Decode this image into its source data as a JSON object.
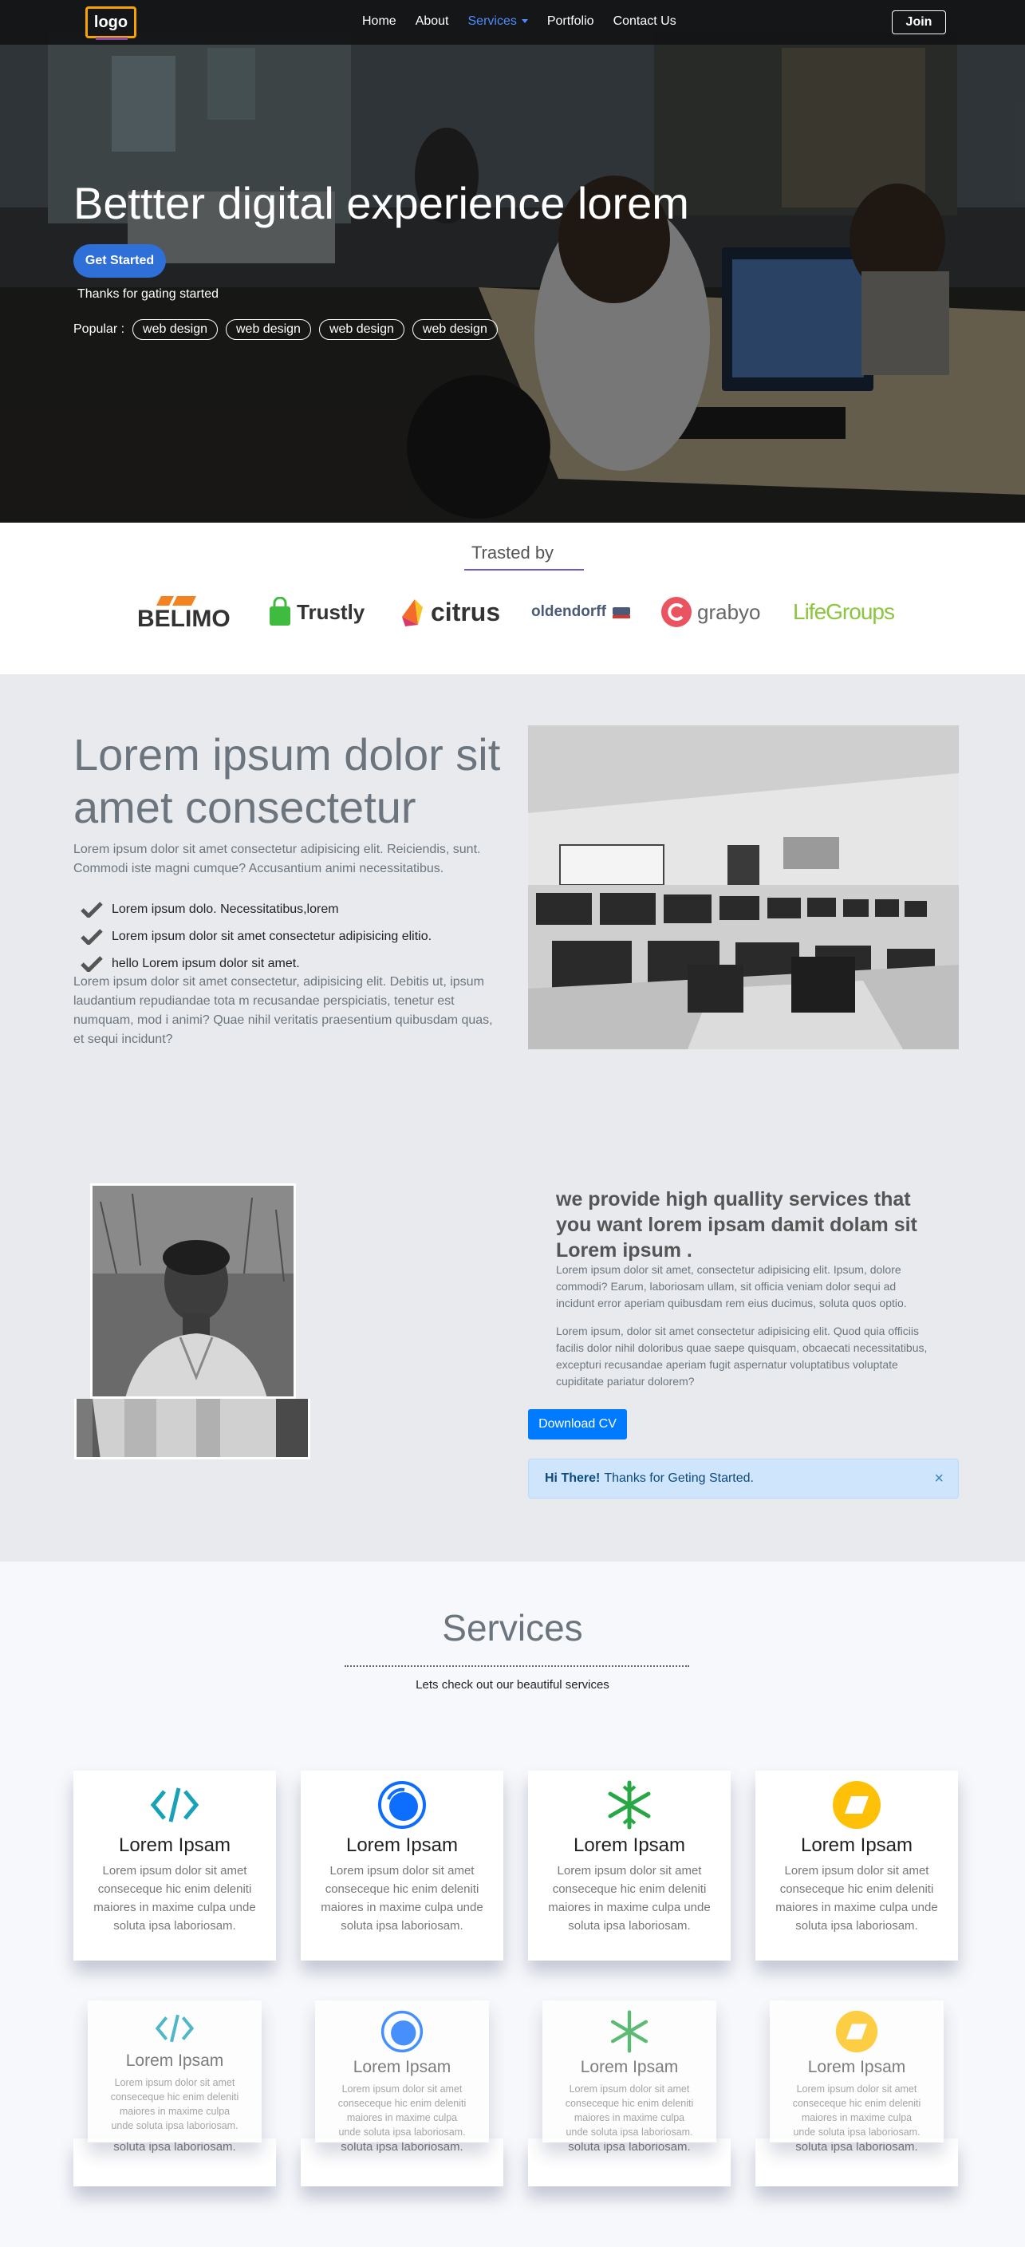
{
  "nav": {
    "logo": "logo",
    "links": [
      "Home",
      "About",
      "Services",
      "Portfolio",
      "Contact Us"
    ],
    "join": "Join"
  },
  "hero": {
    "title": "Bettter digital experience lorem",
    "cta": "Get Started",
    "thanks": "Thanks for gating started",
    "popular_label": "Popular :",
    "tags": [
      "web design",
      "web design",
      "web design",
      "web design"
    ]
  },
  "trusted": {
    "title": "Trasted by",
    "brands": [
      "BELIMO",
      "Trustly",
      "citrus",
      "oldendorff",
      "grabyo",
      "LifeGroups"
    ]
  },
  "about": {
    "heading": "Lorem ipsum dolor sit amet consectetur",
    "intro": "Lorem ipsum dolor sit amet consectetur adipisicing elit. Reiciendis, sunt. Commodi iste magni cumque? Accusantium animi necessitatibus.",
    "checks": [
      "Lorem ipsum dolo. Necessitatibus,lorem",
      "Lorem ipsum dolor sit amet consectetur adipisicing elitio.",
      "hello Lorem ipsum dolor sit amet."
    ],
    "body": "Lorem ipsum dolor sit amet consectetur, adipisicing elit. Debitis ut, ipsum laudantium repudiandae tota m recusandae perspiciatis, tenetur est numquam, mod i animi? Quae nihil veritatis praesentium quibusdam quas, et sequi incidunt?"
  },
  "profile": {
    "heading": "we provide high quallity services that you want lorem ipsam damit dolam sit Lorem ipsum .",
    "p1": "Lorem ipsum dolor sit amet, consectetur adipisicing elit. Ipsum, dolore commodi? Earum, laboriosam ullam, sit officia veniam dolor sequi ad incidunt error aperiam quibusdam rem eius ducimus, soluta quos optio.",
    "p2": "Lorem ipsum, dolor sit amet consectetur adipisicing elit. Quod quia officiis facilis dolor nihil doloribus quae saepe quisquam, obcaecati necessitatibus, excepturi recusandae aperiam fugit aspernatur voluptatibus voluptate cupiditate pariatur dolorem?",
    "cv": "Download CV",
    "alert_strong": "Hi There!",
    "alert_text": "Thanks for Geting Started.",
    "alert_close": "×"
  },
  "services": {
    "title": "Services",
    "subtitle": "Lets check out our beautiful services",
    "card_title": "Lorem Ipsam",
    "card_text": "Lorem ipsum dolor sit amet conseceque hic enim deleniti maiores in maxime culpa unde soluta ipsa laboriosam.",
    "card_base_text": "soluta ipsa laboriosam.",
    "icons": [
      "code-icon",
      "circle-swirl-icon",
      "snowflake-icon",
      "parallelogram-icon"
    ],
    "colors": [
      "#17a2b8",
      "#0d6efd",
      "#28a745",
      "#ffc107"
    ]
  }
}
